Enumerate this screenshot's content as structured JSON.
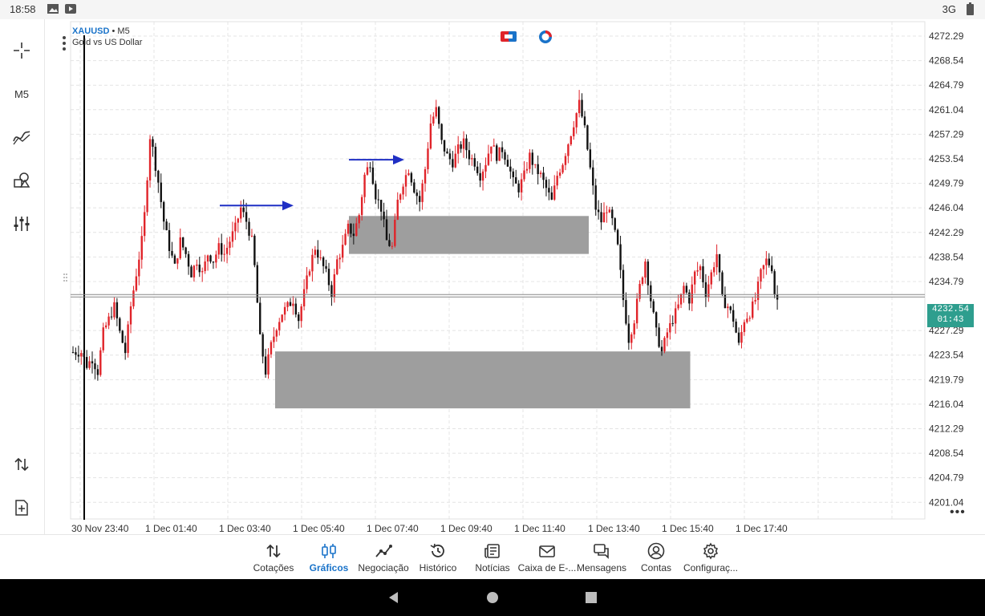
{
  "status_bar": {
    "time": "18:58",
    "network": "3G"
  },
  "toolbar": {
    "items": [
      {
        "name": "crosshair-icon"
      },
      {
        "name": "timeframe-button",
        "label": "M5"
      },
      {
        "name": "indicators-icon"
      },
      {
        "name": "objects-icon"
      },
      {
        "name": "settings-sliders-icon"
      },
      {
        "name": "trade-arrows-icon"
      },
      {
        "name": "new-order-icon"
      }
    ]
  },
  "chart": {
    "symbol": "XAUUSD",
    "timeframe": "• M5",
    "description": "Gold vs US Dollar",
    "current_price": "4232.54",
    "countdown": "01:43",
    "colors": {
      "bull": "#e0242a",
      "bear": "#111111",
      "zone": "#9e9e9e",
      "arrow": "#1f2fc4",
      "price_tag": "#2e9e8e",
      "axis_label": "#333333"
    }
  },
  "chart_data": {
    "type": "candlestick",
    "symbol": "XAUUSD",
    "ylim": [
      4198.5,
      4274.5
    ],
    "y_ticks": [
      "4272.29",
      "4268.54",
      "4264.79",
      "4261.04",
      "4257.29",
      "4253.54",
      "4249.79",
      "4246.04",
      "4242.29",
      "4238.54",
      "4234.79",
      "4227.29",
      "4223.54",
      "4219.79",
      "4216.04",
      "4212.29",
      "4208.54",
      "4204.79",
      "4201.04"
    ],
    "x_ticks": [
      "30 Nov 23:40",
      "1 Dec 01:40",
      "1 Dec 03:40",
      "1 Dec 05:40",
      "1 Dec 07:40",
      "1 Dec 09:40",
      "1 Dec 11:40",
      "1 Dec 13:40",
      "1 Dec 15:40",
      "1 Dec 17:40"
    ],
    "close_path": [
      [
        0,
        4224
      ],
      [
        3,
        4224
      ],
      [
        5,
        4222
      ],
      [
        7,
        4223
      ],
      [
        9,
        4221
      ],
      [
        11,
        4227
      ],
      [
        13,
        4229
      ],
      [
        15,
        4231
      ],
      [
        17,
        4227
      ],
      [
        19,
        4224
      ],
      [
        21,
        4231
      ],
      [
        23,
        4236
      ],
      [
        25,
        4241
      ],
      [
        26,
        4245
      ],
      [
        28,
        4257
      ],
      [
        29,
        4255
      ],
      [
        31,
        4250
      ],
      [
        33,
        4244
      ],
      [
        35,
        4240
      ],
      [
        37,
        4237
      ],
      [
        39,
        4241
      ],
      [
        41,
        4239
      ],
      [
        43,
        4236
      ],
      [
        45,
        4238
      ],
      [
        47,
        4236
      ],
      [
        49,
        4239
      ],
      [
        51,
        4238
      ],
      [
        53,
        4240
      ],
      [
        55,
        4239
      ],
      [
        57,
        4241
      ],
      [
        59,
        4243
      ],
      [
        61,
        4246
      ],
      [
        63,
        4244
      ],
      [
        65,
        4241
      ],
      [
        66,
        4237
      ],
      [
        68,
        4226
      ],
      [
        70,
        4221
      ],
      [
        72,
        4225
      ],
      [
        74,
        4228
      ],
      [
        76,
        4230
      ],
      [
        78,
        4231
      ],
      [
        80,
        4232
      ],
      [
        82,
        4229
      ],
      [
        84,
        4233
      ],
      [
        86,
        4237
      ],
      [
        88,
        4240
      ],
      [
        90,
        4238
      ],
      [
        92,
        4236
      ],
      [
        94,
        4233
      ],
      [
        96,
        4238
      ],
      [
        98,
        4240
      ],
      [
        100,
        4243
      ],
      [
        102,
        4242
      ],
      [
        104,
        4245
      ],
      [
        106,
        4251
      ],
      [
        108,
        4253
      ],
      [
        110,
        4248
      ],
      [
        112,
        4246
      ],
      [
        114,
        4241
      ],
      [
        116,
        4240
      ],
      [
        118,
        4247
      ],
      [
        120,
        4250
      ],
      [
        122,
        4252
      ],
      [
        124,
        4249
      ],
      [
        126,
        4247
      ],
      [
        128,
        4252
      ],
      [
        130,
        4259
      ],
      [
        132,
        4261
      ],
      [
        134,
        4256
      ],
      [
        136,
        4254
      ],
      [
        138,
        4253
      ],
      [
        140,
        4255
      ],
      [
        142,
        4256
      ],
      [
        144,
        4254
      ],
      [
        146,
        4253
      ],
      [
        148,
        4251
      ],
      [
        150,
        4253
      ],
      [
        152,
        4256
      ],
      [
        154,
        4254
      ],
      [
        156,
        4255
      ],
      [
        158,
        4253
      ],
      [
        160,
        4250
      ],
      [
        162,
        4249
      ],
      [
        164,
        4251
      ],
      [
        166,
        4254
      ],
      [
        168,
        4252
      ],
      [
        170,
        4251
      ],
      [
        172,
        4249
      ],
      [
        174,
        4247
      ],
      [
        176,
        4251
      ],
      [
        178,
        4253
      ],
      [
        180,
        4256
      ],
      [
        182,
        4259
      ],
      [
        184,
        4262
      ],
      [
        186,
        4258
      ],
      [
        188,
        4252
      ],
      [
        190,
        4246
      ],
      [
        192,
        4244
      ],
      [
        194,
        4246
      ],
      [
        196,
        4244
      ],
      [
        198,
        4240
      ],
      [
        200,
        4232
      ],
      [
        202,
        4226
      ],
      [
        204,
        4229
      ],
      [
        206,
        4234
      ],
      [
        208,
        4238
      ],
      [
        210,
        4232
      ],
      [
        212,
        4227
      ],
      [
        214,
        4224
      ],
      [
        216,
        4227
      ],
      [
        218,
        4229
      ],
      [
        220,
        4231
      ],
      [
        222,
        4234
      ],
      [
        224,
        4232
      ],
      [
        226,
        4236
      ],
      [
        228,
        4237
      ],
      [
        230,
        4233
      ],
      [
        232,
        4236
      ],
      [
        234,
        4239
      ],
      [
        236,
        4232
      ],
      [
        238,
        4231
      ],
      [
        240,
        4229
      ],
      [
        242,
        4225
      ],
      [
        244,
        4229
      ],
      [
        246,
        4230
      ],
      [
        248,
        4232
      ],
      [
        250,
        4236
      ],
      [
        252,
        4238
      ],
      [
        254,
        4237
      ],
      [
        255,
        4233
      ],
      [
        256,
        4232
      ]
    ],
    "zones": [
      {
        "from_time": "1 Dec 07:10",
        "to_time": "1 Dec 13:40",
        "price_top": 4244.8,
        "price_bottom": 4239.0
      },
      {
        "from_time": "1 Dec 05:10",
        "to_time": "1 Dec 16:25",
        "price_top": 4224.1,
        "price_bottom": 4215.4
      }
    ],
    "arrows": [
      {
        "from_time": "1 Dec 03:40",
        "to_time": "1 Dec 05:40",
        "price": 4246.4
      },
      {
        "from_time": "1 Dec 07:10",
        "to_time": "1 Dec 08:40",
        "price": 4253.4
      }
    ],
    "current_price": 4232.54,
    "grid": true
  },
  "bottom_nav": {
    "items": [
      {
        "label": "Cotações"
      },
      {
        "label": "Gráficos"
      },
      {
        "label": "Negociação"
      },
      {
        "label": "Histórico"
      },
      {
        "label": "Notícias"
      },
      {
        "label": "Caixa de E-..."
      },
      {
        "label": "Mensagens"
      },
      {
        "label": "Contas"
      },
      {
        "label": "Configuraç..."
      }
    ],
    "active_index": 1
  }
}
